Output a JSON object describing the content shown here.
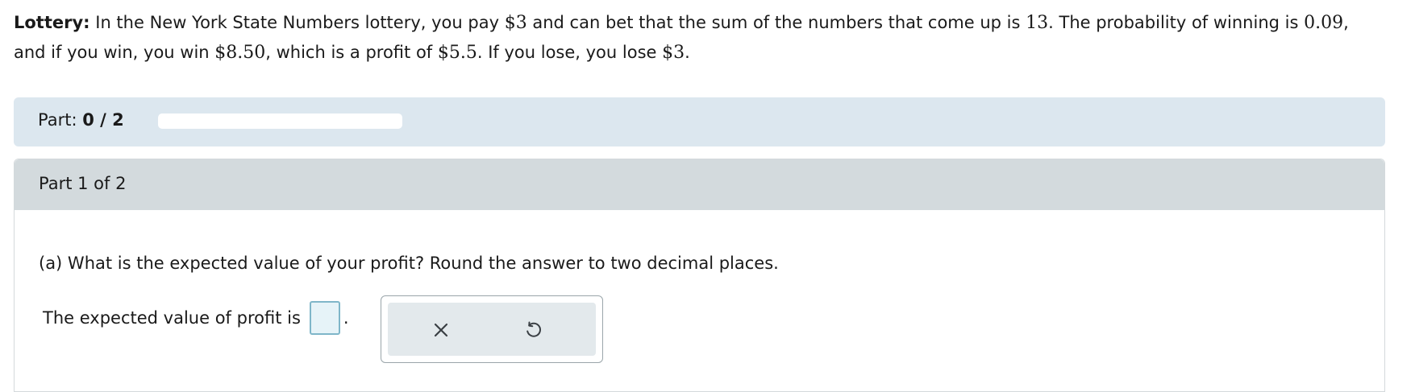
{
  "problem": {
    "label": "Lottery:",
    "t1": " In the New York State Numbers lottery, you pay ",
    "v_pay": "$3",
    "t2": " and can bet that the sum of the numbers that come up is ",
    "v_sum": "13",
    "t3": ". The probability of winning is ",
    "v_prob": "0.09",
    "t4": ", and if you win, you win ",
    "v_win": "$8.50",
    "t5": ", which is a profit of ",
    "v_profit": "$5.5",
    "t6": ". If you lose, you lose ",
    "v_lose": "$3",
    "t7": "."
  },
  "progress": {
    "label": "Part: ",
    "value": "0 / 2",
    "fraction": 0
  },
  "part": {
    "header": "Part 1 of 2",
    "question": "(a) What is the expected value of your profit? Round the answer to two decimal places.",
    "answer_prefix": "The expected value of profit is",
    "answer_suffix": ".",
    "answer_value": ""
  },
  "tools": {
    "clear_icon": "x-icon",
    "undo_icon": "undo-icon"
  }
}
